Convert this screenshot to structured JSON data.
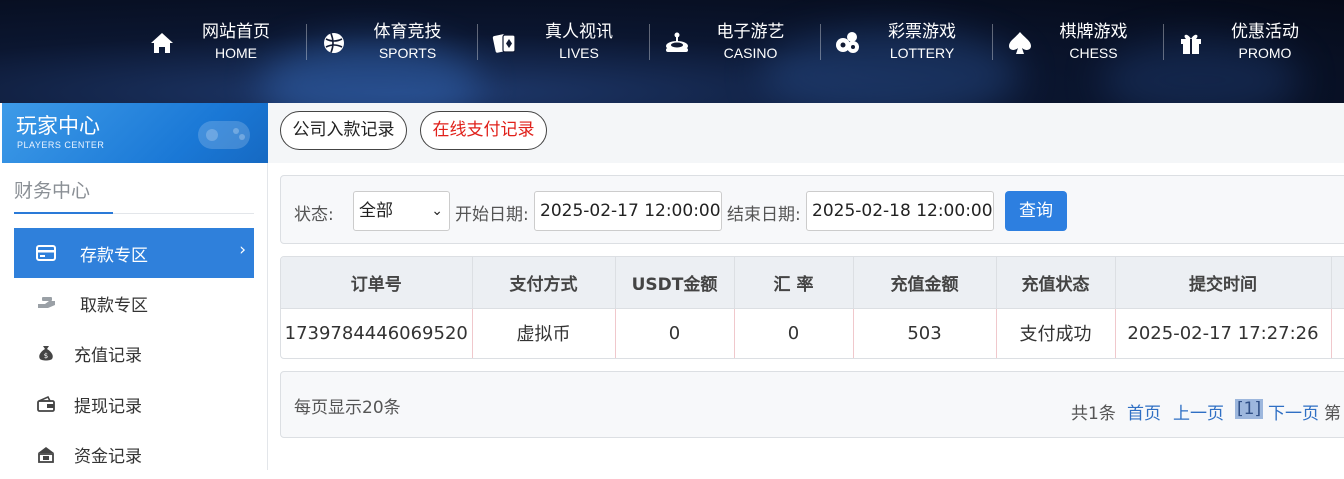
{
  "nav": [
    {
      "cn": "网站首页",
      "en": "HOME",
      "icon": "home-icon"
    },
    {
      "cn": "体育竞技",
      "en": "SPORTS",
      "icon": "ball-icon"
    },
    {
      "cn": "真人视讯",
      "en": "LIVES",
      "icon": "cards-icon"
    },
    {
      "cn": "电子游艺",
      "en": "CASINO",
      "icon": "slot-icon"
    },
    {
      "cn": "彩票游戏",
      "en": "LOTTERY",
      "icon": "lottery-icon"
    },
    {
      "cn": "棋牌游戏",
      "en": "CHESS",
      "icon": "spade-icon"
    },
    {
      "cn": "优惠活动",
      "en": "PROMO",
      "icon": "gift-icon"
    }
  ],
  "sidebar": {
    "banner_title": "玩家中心",
    "banner_sub": "PLAYERS CENTER",
    "section_title": "财务中心",
    "items": [
      {
        "label": "存款专区",
        "icon": "card-icon",
        "active": true
      },
      {
        "label": "取款专区",
        "icon": "withdraw-icon"
      },
      {
        "label": "充值记录",
        "icon": "money-bag-icon"
      },
      {
        "label": "提现记录",
        "icon": "wallet-icon"
      },
      {
        "label": "资金记录",
        "icon": "ledger-icon"
      }
    ]
  },
  "tabs": {
    "company": "公司入款记录",
    "online": "在线支付记录"
  },
  "filter": {
    "status_label": "状态:",
    "status_value": "全部",
    "start_label": "开始日期:",
    "start_value": "2025-02-17 12:00:00",
    "end_label": "结束日期:",
    "end_value": "2025-02-18 12:00:00",
    "query_button": "查询"
  },
  "table": {
    "headers": [
      "订单号",
      "支付方式",
      "USDT金额",
      "汇 率",
      "充值金额",
      "充值状态",
      "提交时间"
    ],
    "rows": [
      [
        "1739784446069520",
        "虚拟币",
        "0",
        "0",
        "503",
        "支付成功",
        "2025-02-17 17:27:26"
      ]
    ]
  },
  "pager": {
    "per_page": "每页显示20条",
    "total": "共1条",
    "first": "首页",
    "prev": "上一页",
    "current": "[1]",
    "next": "下一页",
    "go": "第"
  },
  "colors": {
    "accent": "#2d7fe0",
    "online_tab": "#e0201a",
    "active_side": "#2f80db"
  }
}
